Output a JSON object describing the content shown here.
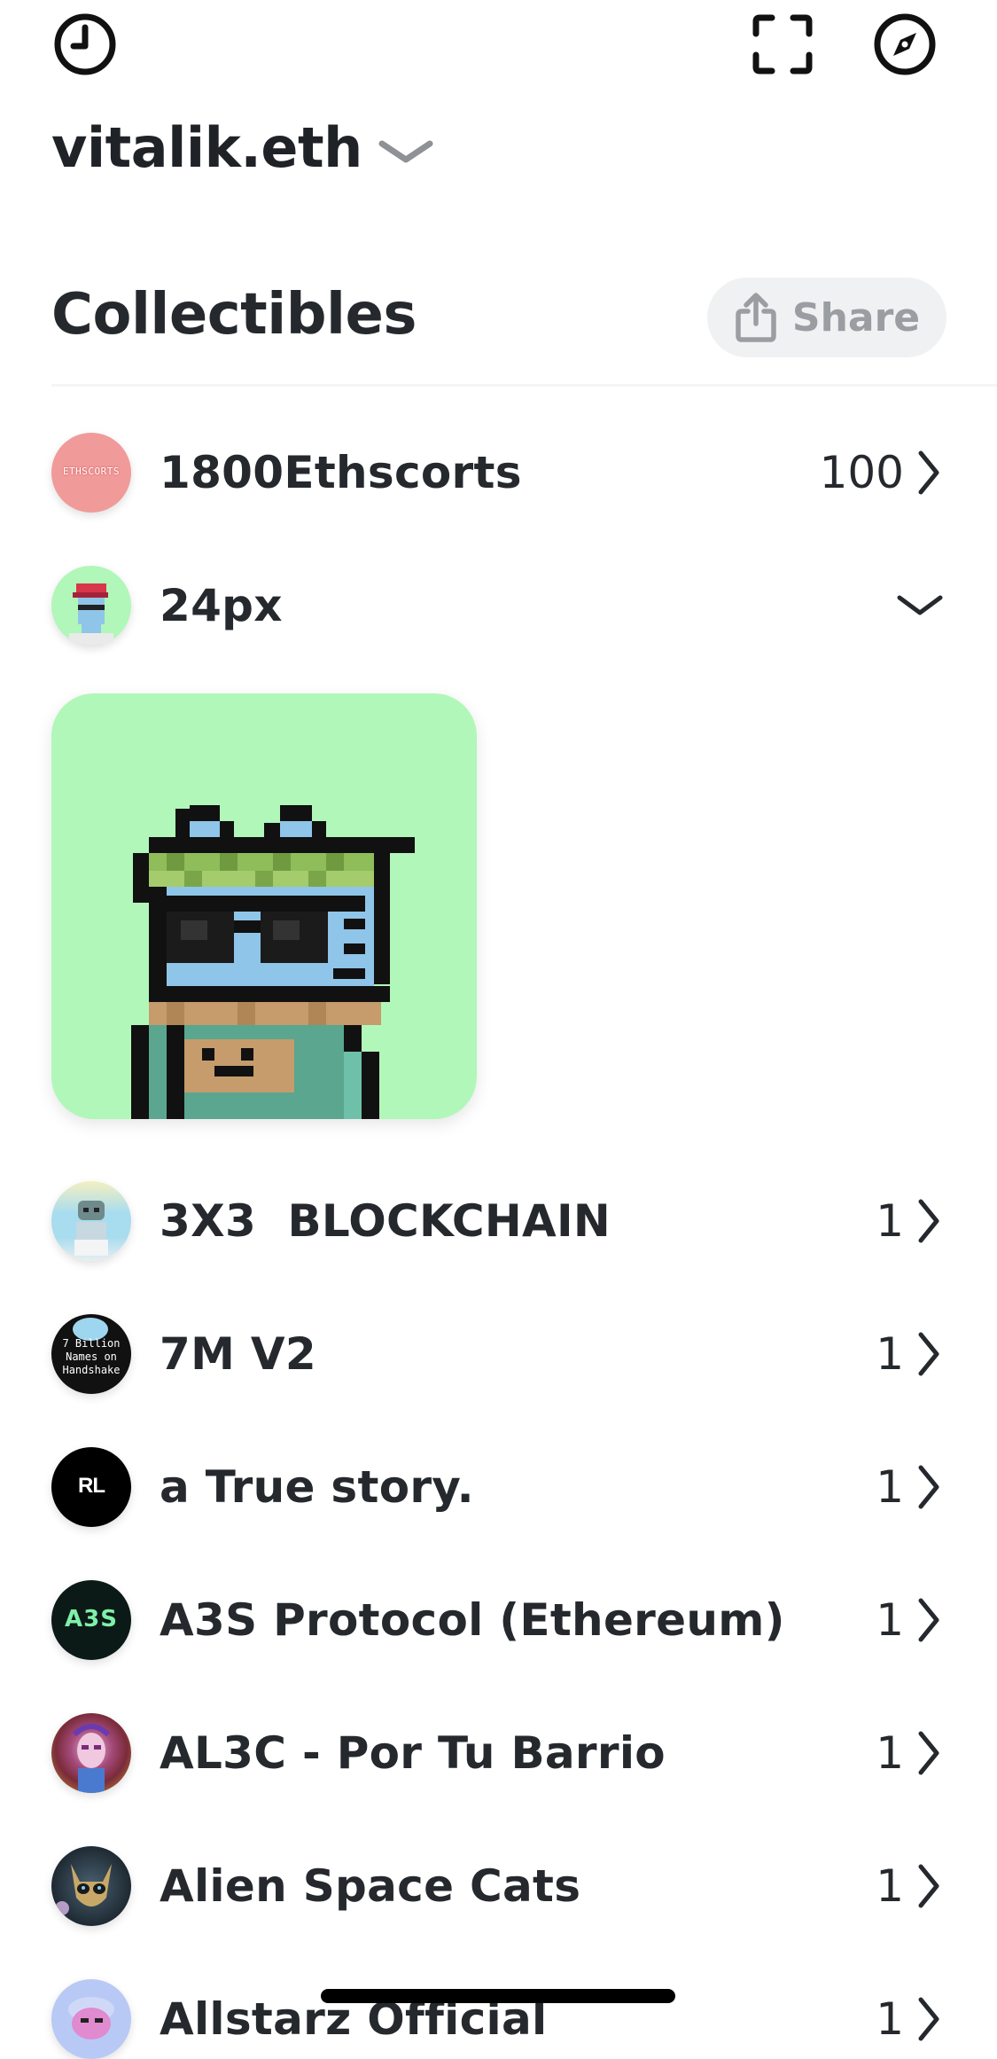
{
  "header": {
    "history_icon": "clock-icon",
    "scan_icon": "scan-frame-icon",
    "discover_icon": "compass-icon",
    "wallet_name": "vitalik.eth",
    "wallet_dropdown_icon": "chevron-down-icon"
  },
  "section": {
    "title": "Collectibles",
    "share_label": "Share",
    "share_icon": "share-upload-icon"
  },
  "collections": [
    {
      "name": "1800Ethscorts",
      "count": "100",
      "avatar_text": "ETHSCORTS",
      "avatar_color": "#f19a9a",
      "expanded": false
    },
    {
      "name": "24px",
      "count": "",
      "avatar_color": "#b1f7b9",
      "expanded": true
    },
    {
      "name": "3X3  BLOCKCHAIN",
      "count": "1",
      "avatar_color": "#a8dcef",
      "expanded": false
    },
    {
      "name": "7M V2",
      "count": "1",
      "avatar_text": "7 Billion Names on Handshake",
      "avatar_color": "#111111",
      "expanded": false
    },
    {
      "name": "a True story.",
      "count": "1",
      "avatar_text": "RL",
      "avatar_color": "#000000",
      "expanded": false
    },
    {
      "name": "A3S Protocol (Ethereum)",
      "count": "1",
      "avatar_text": "A3S",
      "avatar_color": "#0c1a17",
      "expanded": false
    },
    {
      "name": "AL3C - Por Tu Barrio",
      "count": "1",
      "avatar_color": "#7a2b3a",
      "expanded": false
    },
    {
      "name": "Alien Space Cats",
      "count": "1",
      "avatar_color": "#33454f",
      "expanded": false
    },
    {
      "name": "Allstarz Official",
      "count": "1",
      "avatar_color": "#b9c9f5",
      "expanded": false
    }
  ],
  "colors": {
    "text_primary": "#25292e",
    "share_bg": "#f0f1f2",
    "share_text": "#9a9ea3",
    "nft_bg": "#b1f7b9"
  }
}
